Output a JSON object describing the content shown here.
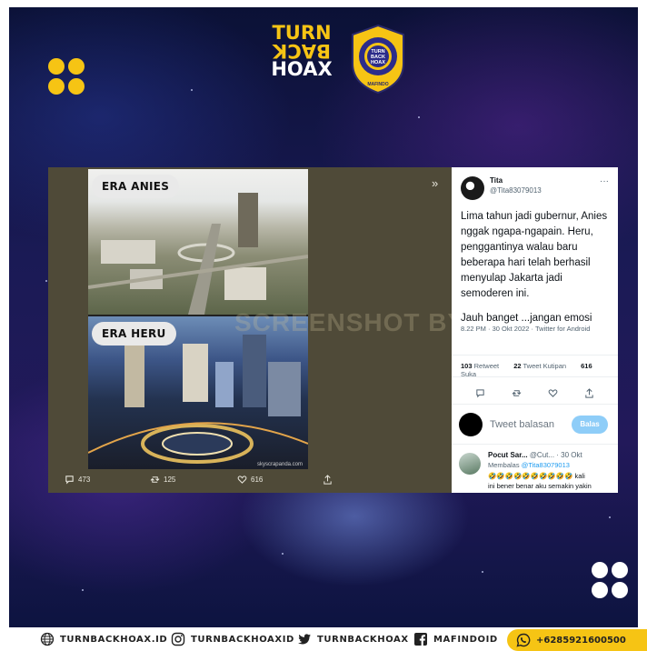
{
  "logo": {
    "line1": "TURN",
    "line2": "BACK",
    "line3": "HOAX",
    "badge_ring_text": "MASYARAKAT ANTI FITNAH INDONESIA",
    "badge_inner": [
      "TURN",
      "BACK",
      "HOAX"
    ],
    "badge_bottom": "MAFINDO"
  },
  "collage": {
    "label_top": "ERA ANIES",
    "label_bottom": "ERA HERU",
    "photo_credit": "skyscrapanda.com"
  },
  "watermark": "SCREENSHOT BY",
  "expand_glyph": "»",
  "left_actions": {
    "replies": "473",
    "retweets": "125",
    "likes": "616"
  },
  "tweet": {
    "name": "Tita",
    "handle": "@Tita83079013",
    "more": "···",
    "paragraph1": "Lima tahun jadi gubernur, Anies nggak ngapa-ngapain. Heru, penggantinya walau baru beberapa hari telah berhasil menyulap Jakarta jadi semoderen ini.",
    "paragraph2": "Jauh banget ...jangan emosi",
    "meta": "8.22 PM · 30 Okt 2022 · Twitter for Android",
    "stats": {
      "retweets_count": "103",
      "retweets_label": "Retweet",
      "quotes_count": "22",
      "quotes_label": "Tweet Kutipan",
      "likes_count": "616",
      "likes_label": "Suka"
    },
    "reply_placeholder": "Tweet balasan",
    "reply_button": "Balas",
    "reply": {
      "name": "Pocut Sar...",
      "handle_time": "@Cut... · 30 Okt",
      "replying_prefix": "Membalas",
      "replying_to": "@Tita83079013",
      "emojis": "🤣🤣🤣🤣🤣🤣🤣🤣🤣🤣",
      "text_tail": "kali",
      "text": "ini bener benar aku semakin yakin"
    }
  },
  "footer": {
    "website": "TURNBACKHOAX.ID",
    "instagram": "TURNBACKHOAXID",
    "twitter": "TURNBACKHOAX",
    "facebook": "MAFINDOID",
    "whatsapp": "+6285921600500"
  },
  "colors": {
    "accent_yellow": "#f6c414",
    "background_navy": "#141a4d",
    "twitter_blue": "#1d9bf0"
  }
}
